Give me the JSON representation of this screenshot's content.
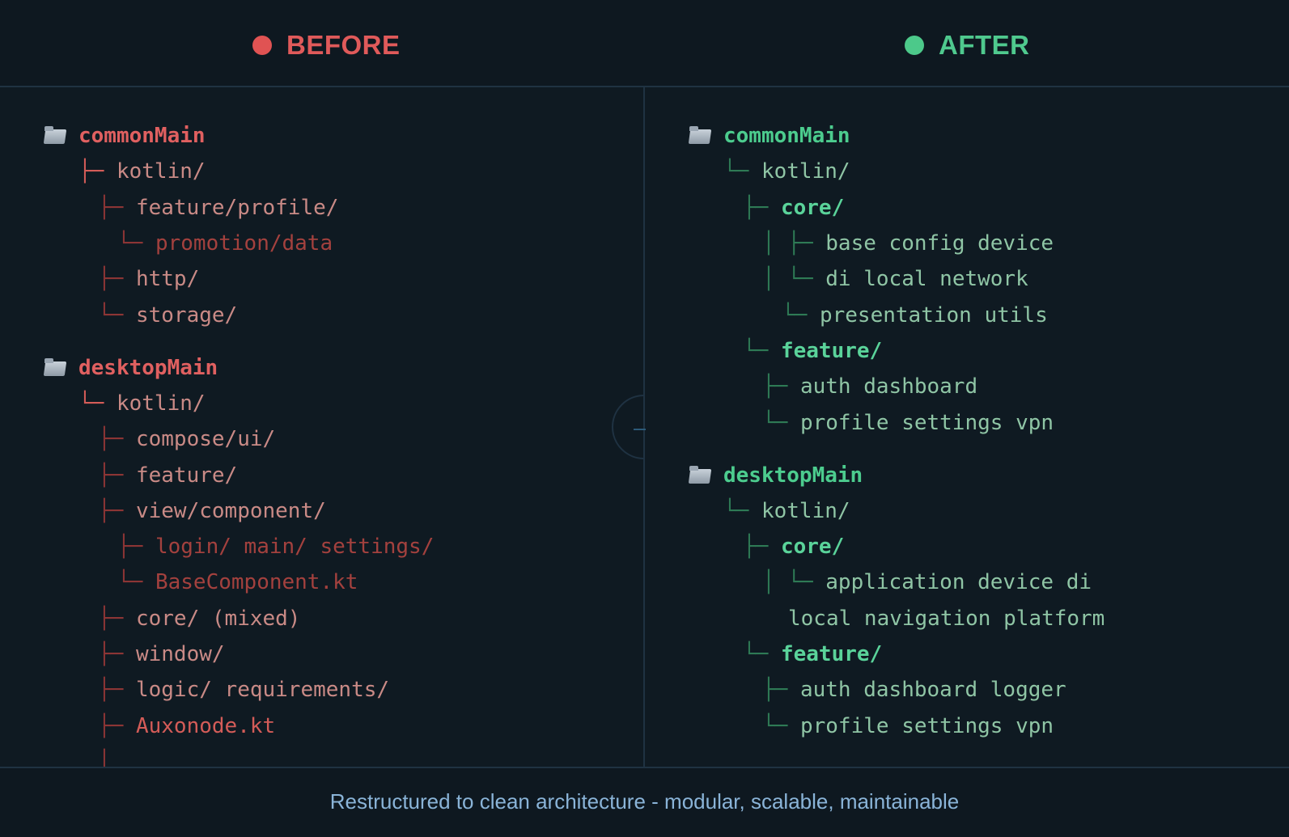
{
  "header": {
    "before_label": "BEFORE",
    "after_label": "AFTER"
  },
  "before": {
    "common_root": "commonMain",
    "common_lines": [
      "kotlin/",
      "feature/profile/",
      "promotion/data",
      "http/",
      "storage/"
    ],
    "desktop_root": "desktopMain",
    "desktop_lines": [
      "kotlin/",
      "compose/ui/",
      "feature/",
      "view/component/",
      "login/ main/ settings/",
      "BaseComponent.kt",
      "core/ (mixed)",
      "window/",
      "logic/ requirements/",
      "Auxonode.kt"
    ]
  },
  "after": {
    "common_root": "commonMain",
    "common_lines": [
      "kotlin/",
      "core/",
      "base config device",
      "di local network",
      "presentation utils",
      "feature/",
      "auth dashboard",
      "profile settings vpn"
    ],
    "desktop_root": "desktopMain",
    "desktop_lines": [
      "kotlin/",
      "core/",
      "application device di",
      "local navigation platform",
      "feature/",
      "auth dashboard logger",
      "profile settings vpn"
    ]
  },
  "footer": {
    "caption": "Restructured to clean architecture - modular, scalable, maintainable"
  },
  "colors": {
    "before_accent": "#e05353",
    "after_accent": "#4cc98a",
    "caption": "#8ab4d8"
  },
  "icons": [
    "folder-icon"
  ]
}
